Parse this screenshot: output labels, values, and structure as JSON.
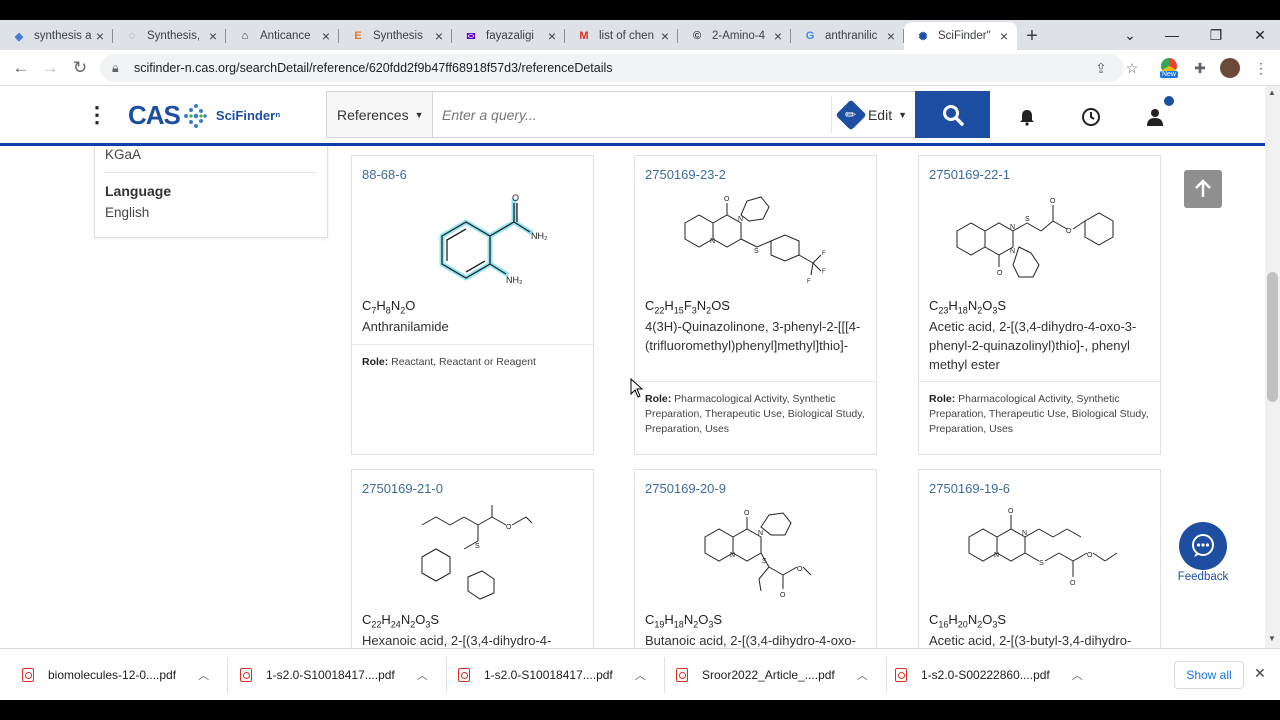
{
  "browser": {
    "tabs": [
      {
        "title": "synthesis a",
        "icon": "gem-icon",
        "color": "#4a7bd8"
      },
      {
        "title": "Synthesis,",
        "icon": "loading-icon",
        "color": "#777"
      },
      {
        "title": "Anticance",
        "icon": "sciencedirect-icon",
        "color": "#333"
      },
      {
        "title": "Synthesis",
        "icon": "e-icon",
        "color": "#e07a2b"
      },
      {
        "title": "fayazaligi",
        "icon": "yahoo-mail-icon",
        "color": "#6001d2"
      },
      {
        "title": "list of chen",
        "icon": "gmail-icon",
        "color": "#d93025"
      },
      {
        "title": "2-Amino-4",
        "icon": "copyright-icon",
        "color": "#333"
      },
      {
        "title": "anthranilic",
        "icon": "google-icon",
        "color": "#4285f4"
      },
      {
        "title": "SciFinder\"",
        "icon": "scifinder-icon",
        "color": "#1d4ea1"
      }
    ],
    "url": "scifinder-n.cas.org/searchDetail/reference/620fdd2f9b47ff68918f57d3/referenceDetails",
    "new_badge": "New"
  },
  "header": {
    "logo_text": "CAS",
    "logo_product": "SciFinderⁿ",
    "search_scope": "References",
    "search_placeholder": "Enter a query...",
    "edit_label": "Edit"
  },
  "sidebar": {
    "publisher_tail": "KGaA",
    "language_heading": "Language",
    "language_value": "English"
  },
  "substances": [
    {
      "cas": "88-68-6",
      "formula": [
        "C",
        "7",
        "H",
        "8",
        "N",
        "2",
        "O",
        ""
      ],
      "name": "Anthranilamide",
      "role_label": "Role:",
      "roles": "Reactant, Reactant or Reagent"
    },
    {
      "cas": "2750169-23-2",
      "formula": [
        "C",
        "22",
        "H",
        "15",
        "F",
        "3",
        "N",
        "2",
        "OS",
        ""
      ],
      "name": "4(3H)-Quinazolinone, 3-phenyl-2-[[[4-(trifluoromethyl)phenyl]methyl]thio]-",
      "role_label": "Role:",
      "roles": "Pharmacological Activity, Synthetic Preparation, Therapeutic Use, Biological Study, Preparation, Uses"
    },
    {
      "cas": "2750169-22-1",
      "formula": [
        "C",
        "23",
        "H",
        "18",
        "N",
        "2",
        "O",
        "3",
        "S",
        ""
      ],
      "name": "Acetic acid, 2-[(3,4-dihydro-4-oxo-3-phenyl-2-quinazolinyl)thio]-, phenyl methyl ester",
      "role_label": "Role:",
      "roles": "Pharmacological Activity, Synthetic Preparation, Therapeutic Use, Biological Study, Preparation, Uses"
    },
    {
      "cas": "2750169-21-0",
      "formula": [
        "C",
        "22",
        "H",
        "24",
        "N",
        "2",
        "O",
        "3",
        "S",
        ""
      ],
      "name": "Hexanoic acid, 2-[(3,4-dihydro-4-",
      "role_label": "",
      "roles": ""
    },
    {
      "cas": "2750169-20-9",
      "formula": [
        "C",
        "19",
        "H",
        "18",
        "N",
        "2",
        "O",
        "3",
        "S",
        ""
      ],
      "name": "Butanoic acid, 2-[(3,4-dihydro-4-oxo-",
      "role_label": "",
      "roles": ""
    },
    {
      "cas": "2750169-19-6",
      "formula": [
        "C",
        "16",
        "H",
        "20",
        "N",
        "2",
        "O",
        "3",
        "S",
        ""
      ],
      "name": "Acetic acid, 2-[(3-butyl-3,4-dihydro-",
      "role_label": "",
      "roles": ""
    }
  ],
  "feedback_label": "Feedback",
  "downloads": {
    "files": [
      "biomolecules-12-0....pdf",
      "1-s2.0-S10018417....pdf",
      "1-s2.0-S10018417....pdf",
      "Sroor2022_Article_....pdf",
      "1-s2.0-S00222860....pdf"
    ],
    "show_all": "Show all"
  },
  "colors": {
    "accent": "#1d4ea1",
    "link": "#3f6b9d",
    "highlight": "#3ad0e8"
  }
}
